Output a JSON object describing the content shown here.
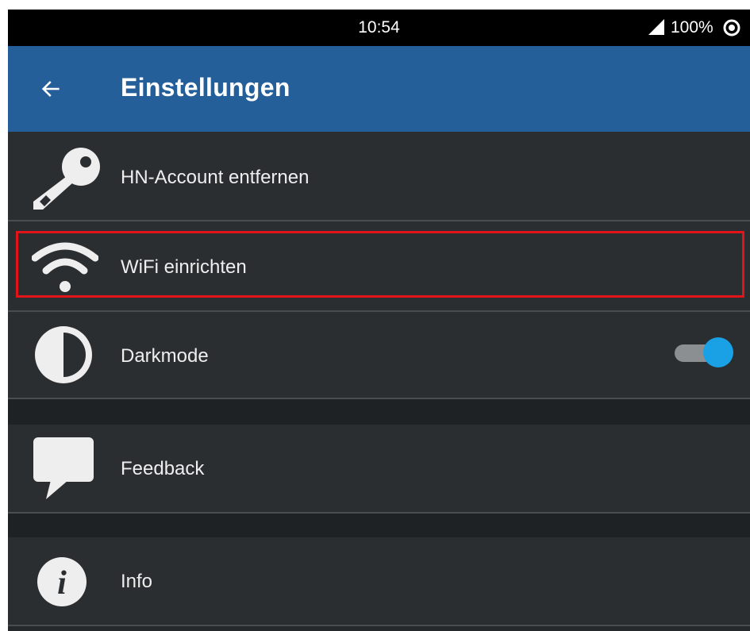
{
  "status_bar": {
    "time": "10:54",
    "battery": "100%",
    "icons": [
      "signal-icon",
      "target-icon"
    ]
  },
  "app_bar": {
    "title": "Einstellungen",
    "back_icon": "arrow-left-icon",
    "color": "#255f99"
  },
  "settings": {
    "items": [
      {
        "label": "HN-Account entfernen",
        "icon": "key-icon"
      },
      {
        "label": "WiFi einrichten",
        "icon": "wifi-icon",
        "highlighted": true
      },
      {
        "label": "Darkmode",
        "icon": "contrast-icon",
        "toggle": true
      },
      {
        "label": "Feedback",
        "icon": "speech-bubble-icon"
      },
      {
        "label": "Info",
        "icon": "info-icon"
      }
    ]
  },
  "colors": {
    "highlight_border": "#e2141a",
    "toggle_accent": "#1aa0e4",
    "background": "#2b2e30"
  }
}
